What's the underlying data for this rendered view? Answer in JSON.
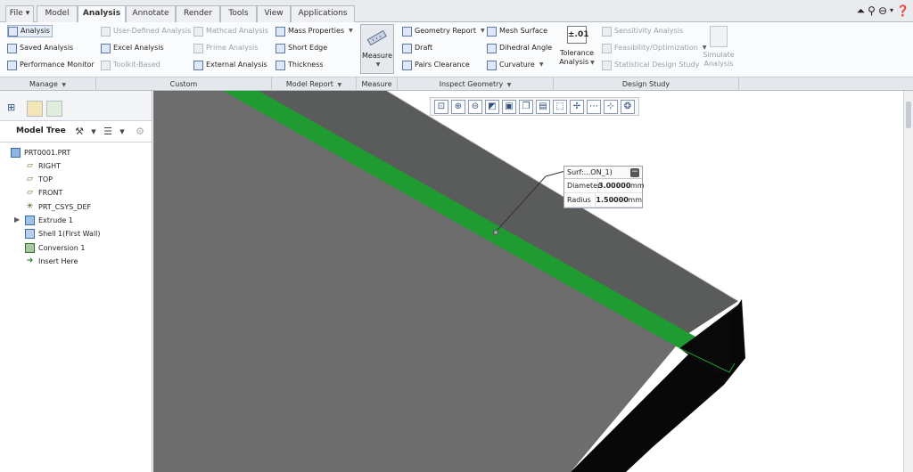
{
  "menu": {
    "tabs": [
      {
        "label": "File"
      },
      {
        "label": "Model"
      },
      {
        "label": "Analysis"
      },
      {
        "label": "Annotate"
      },
      {
        "label": "Render"
      },
      {
        "label": "Tools"
      },
      {
        "label": "View"
      },
      {
        "label": "Applications"
      }
    ],
    "file_caret": "▾",
    "right_icons": [
      "up-arrow-icon",
      "search-icon",
      "settings-icon",
      "help-icon"
    ]
  },
  "ribbon": {
    "manage": {
      "analysis": "Analysis",
      "saved_analysis": "Saved Analysis",
      "performance_monitor": "Performance Monitor"
    },
    "custom": {
      "user_defined_analysis": "User-Defined Analysis",
      "excel_analysis": "Excel Analysis",
      "toolkit_based": "Toolkit-Based",
      "mathcad_analysis": "Mathcad Analysis",
      "prime_analysis": "Prime Analysis",
      "external_analysis": "External Analysis"
    },
    "model_report": {
      "mass_properties": "Mass Properties",
      "short_edge": "Short Edge",
      "thickness": "Thickness"
    },
    "measure": {
      "label": "Measure"
    },
    "inspect_geometry": {
      "geometry_report": "Geometry Report",
      "draft": "Draft",
      "pairs_clearance": "Pairs Clearance",
      "mesh_surface": "Mesh Surface",
      "dihedral_angle": "Dihedral Angle",
      "curvature": "Curvature"
    },
    "tolerance": {
      "icon_text": "±.01",
      "line1": "Tolerance",
      "line2": "Analysis"
    },
    "design_study": {
      "sensitivity_analysis": "Sensitivity Analysis",
      "feasibility_optimization": "Feasibility/Optimization",
      "statistical_design_study": "Statistical Design Study",
      "simulate_line1": "Simulate",
      "simulate_line2": "Analysis"
    }
  },
  "groups": {
    "manage": "Manage",
    "custom": "Custom",
    "model_report": "Model Report",
    "measure": "Measure",
    "inspect_geometry": "Inspect Geometry",
    "design_study": "Design Study"
  },
  "model_tree": {
    "title": "Model Tree",
    "nodes": [
      {
        "label": "PRT0001.PRT"
      },
      {
        "label": "RIGHT"
      },
      {
        "label": "TOP"
      },
      {
        "label": "FRONT"
      },
      {
        "label": "PRT_CSYS_DEF"
      },
      {
        "label": "Extrude 1"
      },
      {
        "label": "Shell 1(First Wall)"
      },
      {
        "label": "Conversion 1"
      },
      {
        "label": "Insert Here"
      }
    ]
  },
  "measure_popup": {
    "title": "Surf:...ON_1)",
    "rows": [
      {
        "label": "Diameter",
        "value": "3.00000",
        "unit": "mm"
      },
      {
        "label": "Radius",
        "value": "1.50000",
        "unit": "mm"
      }
    ]
  },
  "colors": {
    "selected_surface": "#1f9b31",
    "plate_top": "#6d6d6d",
    "plate_back": "#5a5b5b",
    "plate_edge": "#080808",
    "ribbon_bg": "#fafbfc"
  }
}
